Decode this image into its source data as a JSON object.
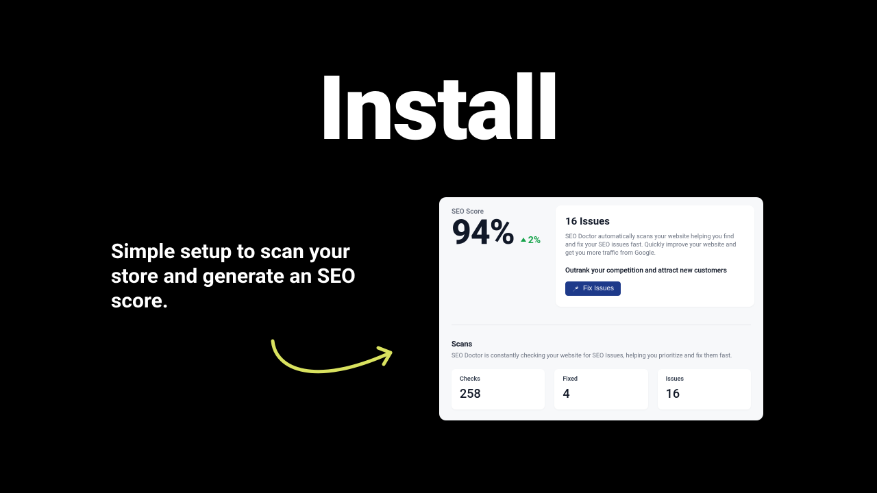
{
  "hero": {
    "title": "Install",
    "subtitle": "Simple setup to scan your store and generate an SEO score."
  },
  "panel": {
    "score": {
      "label": "SEO Score",
      "value": "94%",
      "delta": "2%"
    },
    "issues": {
      "title": "16 Issues",
      "description": "SEO Doctor automatically scans your website helping you find and fix your SEO issues fast. Quickly improve your website and get you more traffic from Google.",
      "cta_text": "Outrank your competition and attract new customers",
      "button_label": "Fix Issues"
    },
    "scans": {
      "title": "Scans",
      "description": "SEO Doctor is constantly checking your website for SEO Issues, helping you prioritize and fix them fast.",
      "stats": [
        {
          "label": "Checks",
          "value": "258"
        },
        {
          "label": "Fixed",
          "value": "4"
        },
        {
          "label": "Issues",
          "value": "16"
        }
      ]
    }
  },
  "colors": {
    "accent_green": "#16a34a",
    "button_bg": "#1e3a8a",
    "arrow": "#d9e25f"
  }
}
